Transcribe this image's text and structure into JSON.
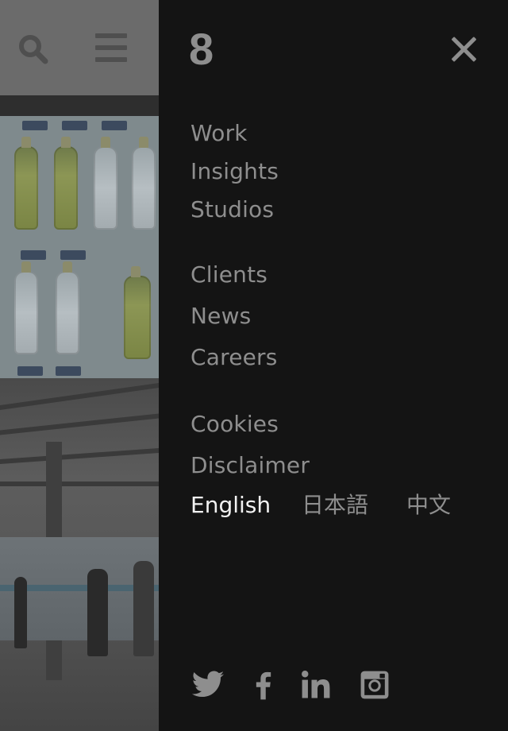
{
  "logo": "8",
  "nav": {
    "group1": [
      "Work",
      "Insights",
      "Studios"
    ],
    "group2": [
      "Clients",
      "News",
      "Careers"
    ],
    "group3": [
      "Cookies",
      "Disclaimer"
    ]
  },
  "languages": [
    "English",
    "日本語",
    "中文"
  ],
  "active_language": "English",
  "icons": {
    "background_header": [
      "search-icon",
      "hamburger-menu-icon"
    ],
    "close": "close-icon",
    "social": [
      "twitter-icon",
      "facebook-icon",
      "linkedin-icon",
      "instagram-icon"
    ]
  },
  "colors": {
    "drawer_background": "#141414",
    "menu_text": "#8e8e8e",
    "active_text": "#f2f2f2"
  }
}
